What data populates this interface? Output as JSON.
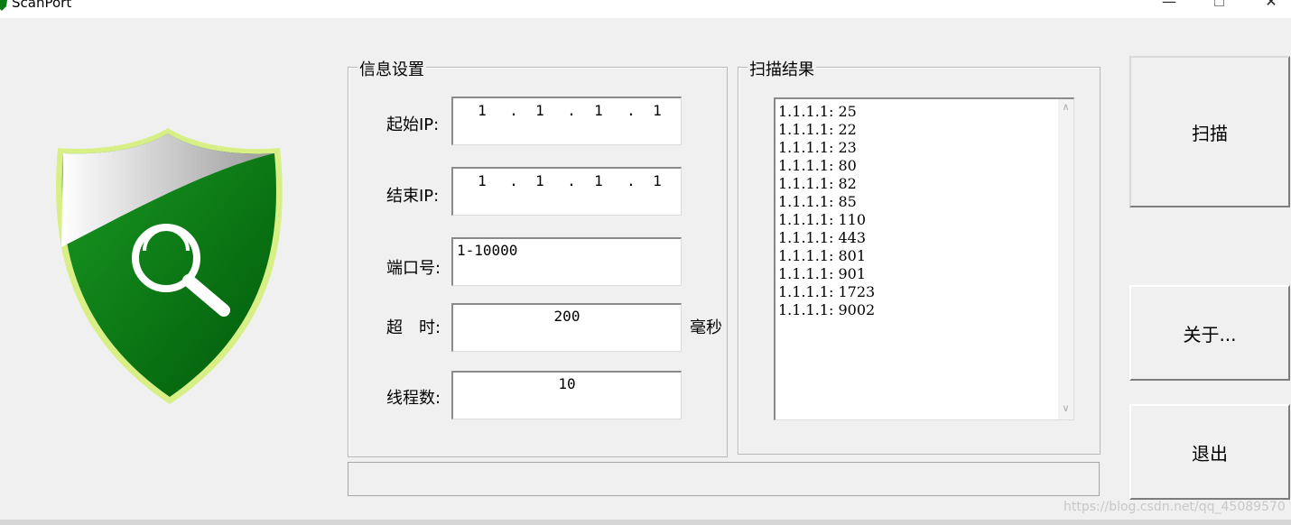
{
  "window": {
    "title": "ScanPort"
  },
  "info_settings": {
    "legend": "信息设置",
    "start_ip": {
      "label": "起始IP:",
      "octets": [
        "1",
        "1",
        "1",
        "1"
      ]
    },
    "end_ip": {
      "label": "结束IP:",
      "octets": [
        "1",
        "1",
        "1",
        "1"
      ]
    },
    "port": {
      "label": "端口号:",
      "value": "1-10000"
    },
    "timeout": {
      "label": "超　时:",
      "value": "200",
      "unit": "毫秒"
    },
    "threads": {
      "label": "线程数:",
      "value": "10"
    }
  },
  "scan_results": {
    "legend": "扫描结果",
    "items": [
      "1.1.1.1: 25",
      "1.1.1.1: 22",
      "1.1.1.1: 23",
      "1.1.1.1: 80",
      "1.1.1.1: 82",
      "1.1.1.1: 85",
      "1.1.1.1: 110",
      "1.1.1.1: 443",
      "1.1.1.1: 801",
      "1.1.1.1: 901",
      "1.1.1.1: 1723",
      "1.1.1.1: 9002"
    ]
  },
  "buttons": {
    "scan": "扫描",
    "about": "关于...",
    "exit": "退出"
  },
  "watermark": "https://blog.csdn.net/qq_45089570",
  "icons": {
    "app": "shield-icon",
    "logo": "shield-magnifier-icon",
    "scroll_up": "chevron-up-icon",
    "scroll_down": "chevron-down-icon"
  },
  "colors": {
    "shield_green": "#0a7a12",
    "shield_rim": "#c9e86a"
  }
}
